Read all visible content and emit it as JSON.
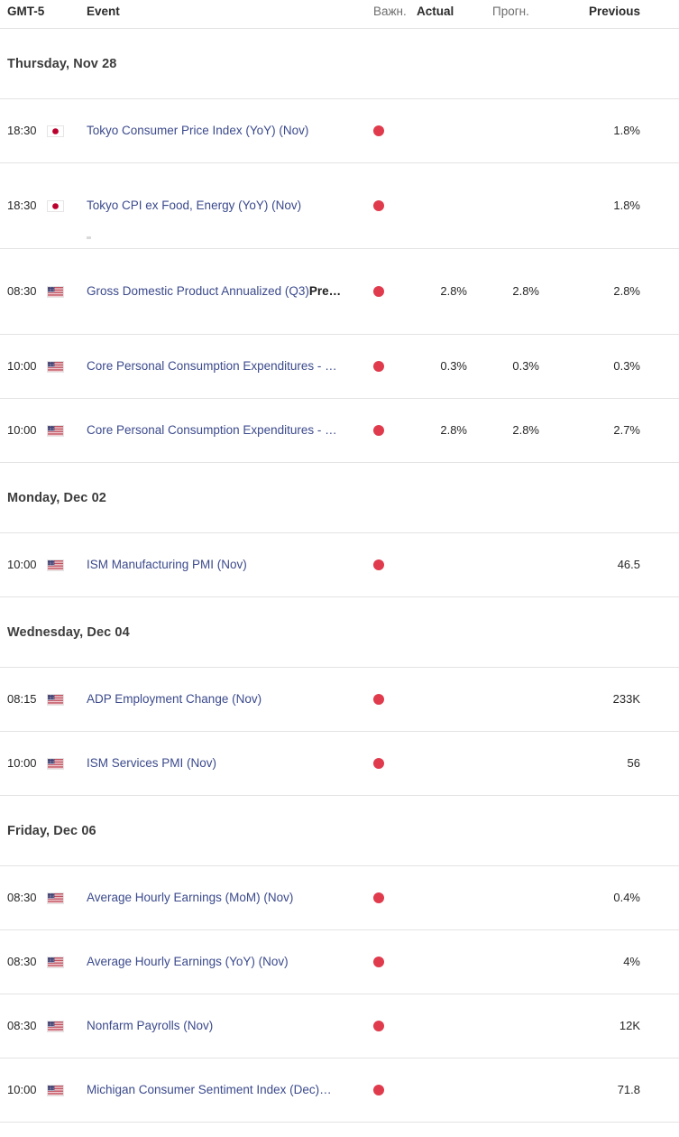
{
  "header": {
    "timezone": "GMT-5",
    "event": "Event",
    "importance": "Важн.",
    "actual": "Actual",
    "forecast": "Прогн.",
    "previous": "Previous"
  },
  "colors": {
    "link": "#3b4a8c",
    "importance_dot": "#e03b4c",
    "divider": "#e3e3e3",
    "date_header": "#3c3c3c",
    "value_text": "#262626"
  },
  "groups": [
    {
      "date_label": "Thursday, Nov 28",
      "rows": [
        {
          "time": "18:30",
          "flag": "japan-flag",
          "event": "Tokyo Consumer Price Index (YoY) (Nov)",
          "event_suffix": "",
          "importance": "high",
          "actual": "",
          "forecast": "",
          "previous": "1.8%"
        },
        {
          "time": "18:30",
          "flag": "japan-flag",
          "event": "Tokyo CPI ex Food, Energy (YoY) (Nov)",
          "event_suffix": "",
          "importance": "high",
          "actual": "",
          "forecast": "",
          "previous": "1.8%"
        },
        {
          "time": "08:30",
          "flag": "usa-flag",
          "event": "Gross Domestic Product Annualized (Q3)",
          "event_suffix": "Pre…",
          "importance": "high",
          "actual": "2.8%",
          "forecast": "2.8%",
          "previous": "2.8%"
        },
        {
          "time": "10:00",
          "flag": "usa-flag",
          "event": "Core Personal Consumption Expenditures - …",
          "event_suffix": "",
          "importance": "high",
          "actual": "0.3%",
          "forecast": "0.3%",
          "previous": "0.3%"
        },
        {
          "time": "10:00",
          "flag": "usa-flag",
          "event": "Core Personal Consumption Expenditures - …",
          "event_suffix": "",
          "importance": "high",
          "actual": "2.8%",
          "forecast": "2.8%",
          "previous": "2.7%"
        }
      ]
    },
    {
      "date_label": "Monday, Dec 02",
      "rows": [
        {
          "time": "10:00",
          "flag": "usa-flag",
          "event": "ISM Manufacturing PMI (Nov)",
          "event_suffix": "",
          "importance": "high",
          "actual": "",
          "forecast": "",
          "previous": "46.5"
        }
      ]
    },
    {
      "date_label": "Wednesday, Dec 04",
      "rows": [
        {
          "time": "08:15",
          "flag": "usa-flag",
          "event": "ADP Employment Change (Nov)",
          "event_suffix": "",
          "importance": "high",
          "actual": "",
          "forecast": "",
          "previous": "233K"
        },
        {
          "time": "10:00",
          "flag": "usa-flag",
          "event": "ISM Services PMI (Nov)",
          "event_suffix": "",
          "importance": "high",
          "actual": "",
          "forecast": "",
          "previous": "56"
        }
      ]
    },
    {
      "date_label": "Friday, Dec 06",
      "rows": [
        {
          "time": "08:30",
          "flag": "usa-flag",
          "event": "Average Hourly Earnings (MoM) (Nov)",
          "event_suffix": "",
          "importance": "high",
          "actual": "",
          "forecast": "",
          "previous": "0.4%"
        },
        {
          "time": "08:30",
          "flag": "usa-flag",
          "event": "Average Hourly Earnings (YoY) (Nov)",
          "event_suffix": "",
          "importance": "high",
          "actual": "",
          "forecast": "",
          "previous": "4%"
        },
        {
          "time": "08:30",
          "flag": "usa-flag",
          "event": "Nonfarm Payrolls (Nov)",
          "event_suffix": "",
          "importance": "high",
          "actual": "",
          "forecast": "",
          "previous": "12K"
        },
        {
          "time": "10:00",
          "flag": "usa-flag",
          "event": "Michigan Consumer Sentiment Index (Dec)…",
          "event_suffix": "",
          "importance": "high",
          "actual": "",
          "forecast": "",
          "previous": "71.8"
        }
      ]
    }
  ]
}
